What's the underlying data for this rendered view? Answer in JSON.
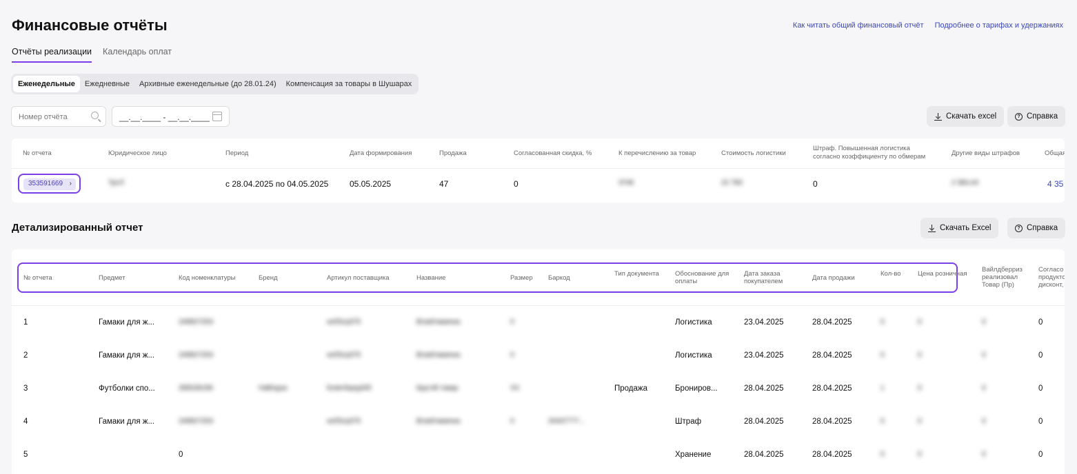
{
  "header": {
    "title": "Финансовые отчёты",
    "links": [
      "Как читать общий финансовый отчёт",
      "Подробнее о тарифах и удержаниях"
    ]
  },
  "tabs": [
    {
      "label": "Отчёты реализации",
      "active": true
    },
    {
      "label": "Календарь оплат",
      "active": false
    }
  ],
  "subtabs": [
    {
      "label": "Еженедельные",
      "active": true
    },
    {
      "label": "Ежедневные",
      "active": false
    },
    {
      "label": "Архивные еженедельные (до 28.01.24)",
      "active": false
    },
    {
      "label": "Компенсация за товары в Шушарах",
      "active": false
    }
  ],
  "filters": {
    "report_number_placeholder": "Номер отчёта",
    "date_range_placeholder": "__.__.____ - __.__.____"
  },
  "top_buttons": {
    "download": "Скачать excel",
    "help": "Справка"
  },
  "reports_table": {
    "headers": [
      "№ отчета",
      "Юридическое лицо",
      "Период",
      "Дата формирования",
      "Продажа",
      "Согласованная скидка, %",
      "К перечислению за товар",
      "Стоимость логистики",
      "Штраф. Повышенная логистика согласно коэффициенту по обмерам",
      "Другие виды штрафов",
      "Общая"
    ],
    "row": {
      "report_no": "353591669",
      "legal_entity": "ТрсЛ",
      "period": "с 28.04.2025 по 04.05.2025",
      "created": "05.05.2025",
      "sale": "47",
      "discount": "0",
      "to_pay": "3746",
      "logistics": "22 783",
      "penalty": "0",
      "other_penalties": "2 384,44",
      "total": "4 35"
    }
  },
  "detailed": {
    "title": "Детализированный отчет",
    "download": "Скачать Excel",
    "help": "Справка",
    "headers": [
      "№ отчета",
      "Предмет",
      "Код номенклатуры",
      "Бренд",
      "Артикул поставщика",
      "Название",
      "Размер",
      "Баркод",
      "Тип документа",
      "Обоснование для оплаты",
      "Дата заказа покупателем",
      "Дата продажи",
      "Кол-во",
      "Цена розничная",
      "Вайлдберриз реализовал Товар (Пр)",
      "Согласо продукто дисконт,"
    ],
    "rows": [
      {
        "n": "1",
        "subject": "Гамаки для ж...",
        "code": "249827203",
        "brand": "",
        "article": "set/5cq375",
        "name": "Влаб/гамачка",
        "size": "0",
        "barcode": "",
        "doc": "",
        "reason": "Логистика",
        "order_date": "23.04.2025",
        "sale_date": "28.04.2025",
        "qty": "0",
        "price": "0",
        "wb": "0",
        "agreed": "0"
      },
      {
        "n": "2",
        "subject": "Гамаки для ж...",
        "code": "249827203",
        "brand": "",
        "article": "set/5cq375",
        "name": "Влаб/гамачка",
        "size": "0",
        "barcode": "",
        "doc": "",
        "reason": "Логистика",
        "order_date": "23.04.2025",
        "sale_date": "28.04.2025",
        "qty": "0",
        "price": "0",
        "wb": "0",
        "agreed": "0"
      },
      {
        "n": "3",
        "subject": "Футболки спо...",
        "code": "285028196",
        "brand": "Hallingsa",
        "article": "footer5qeg345",
        "name": "Круглй товар",
        "size": "XX",
        "barcode": "",
        "doc": "Продажа",
        "reason": "Брониров...",
        "order_date": "28.04.2025",
        "sale_date": "28.04.2025",
        "qty": "1",
        "price": "0",
        "wb": "0",
        "agreed": "0"
      },
      {
        "n": "4",
        "subject": "Гамаки для ж...",
        "code": "249827203",
        "brand": "",
        "article": "set/5cq375",
        "name": "Влаб/гамачка",
        "size": "0",
        "barcode": "20437777...",
        "doc": "",
        "reason": "Штраф",
        "order_date": "28.04.2025",
        "sale_date": "28.04.2025",
        "qty": "0",
        "price": "0",
        "wb": "0",
        "agreed": "0"
      },
      {
        "n": "5",
        "subject": "",
        "code": "0",
        "brand": "",
        "article": "",
        "name": "",
        "size": "",
        "barcode": "",
        "doc": "",
        "reason": "Хранение",
        "order_date": "28.04.2025",
        "sale_date": "28.04.2025",
        "qty": "0",
        "price": "0",
        "wb": "0",
        "agreed": "0"
      }
    ]
  },
  "colors": {
    "accent": "#7b3ee8",
    "link": "#3a46b8"
  }
}
